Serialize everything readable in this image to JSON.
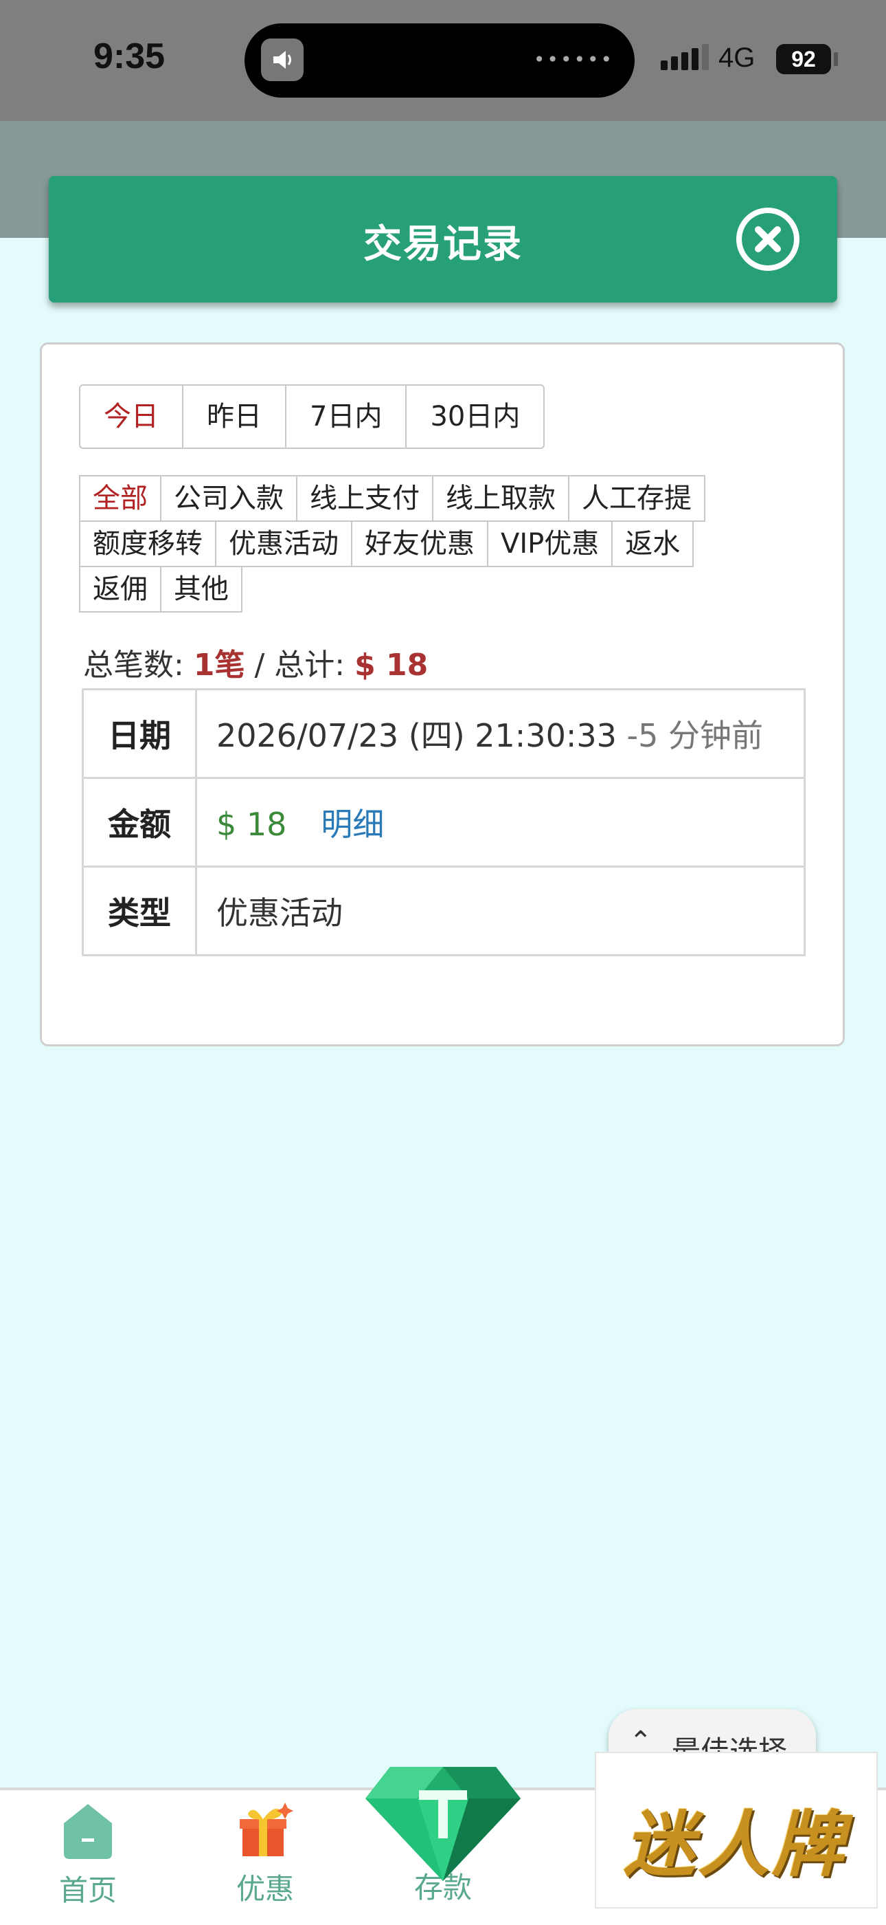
{
  "status_bar": {
    "time": "9:35",
    "network": "4G",
    "battery": "92"
  },
  "header": {
    "title": "交易记录"
  },
  "date_tabs": [
    {
      "label": "今日",
      "active": true
    },
    {
      "label": "昨日",
      "active": false
    },
    {
      "label": "7日内",
      "active": false
    },
    {
      "label": "30日内",
      "active": false
    }
  ],
  "type_filters": [
    {
      "label": "全部",
      "active": true
    },
    {
      "label": "公司入款"
    },
    {
      "label": "线上支付"
    },
    {
      "label": "线上取款"
    },
    {
      "label": "人工存提"
    },
    {
      "label": "额度移转"
    },
    {
      "label": "优惠活动"
    },
    {
      "label": "好友优惠"
    },
    {
      "label": "VIP优惠"
    },
    {
      "label": "返水"
    },
    {
      "label": "返佣"
    },
    {
      "label": "其他"
    }
  ],
  "summary": {
    "count_label": "总笔数:",
    "count": "1笔",
    "sep": " / ",
    "total_label": "总计:",
    "total": "$ 18"
  },
  "record": {
    "date_label": "日期",
    "date_value": "2026/07/23 (四) 21:30:33",
    "ago": "-5 分钟前",
    "amount_label": "金额",
    "amount": "$ 18",
    "detail_link": "明细",
    "type_label": "类型",
    "type_value": "优惠活动"
  },
  "bottom_nav": [
    {
      "label": "首页",
      "icon": "home-icon"
    },
    {
      "label": "优惠",
      "icon": "gift-icon"
    },
    {
      "label": "存款",
      "icon": "diamond-icon"
    }
  ],
  "floating": {
    "best_choice": "最佳选择",
    "brand_logo": "迷人牌"
  },
  "colors": {
    "header": "#27a079",
    "accent_red": "#b22222",
    "amount_green": "#3a8a3a",
    "link_blue": "#2a7ab8",
    "page_bg": "#e3fbfb"
  }
}
